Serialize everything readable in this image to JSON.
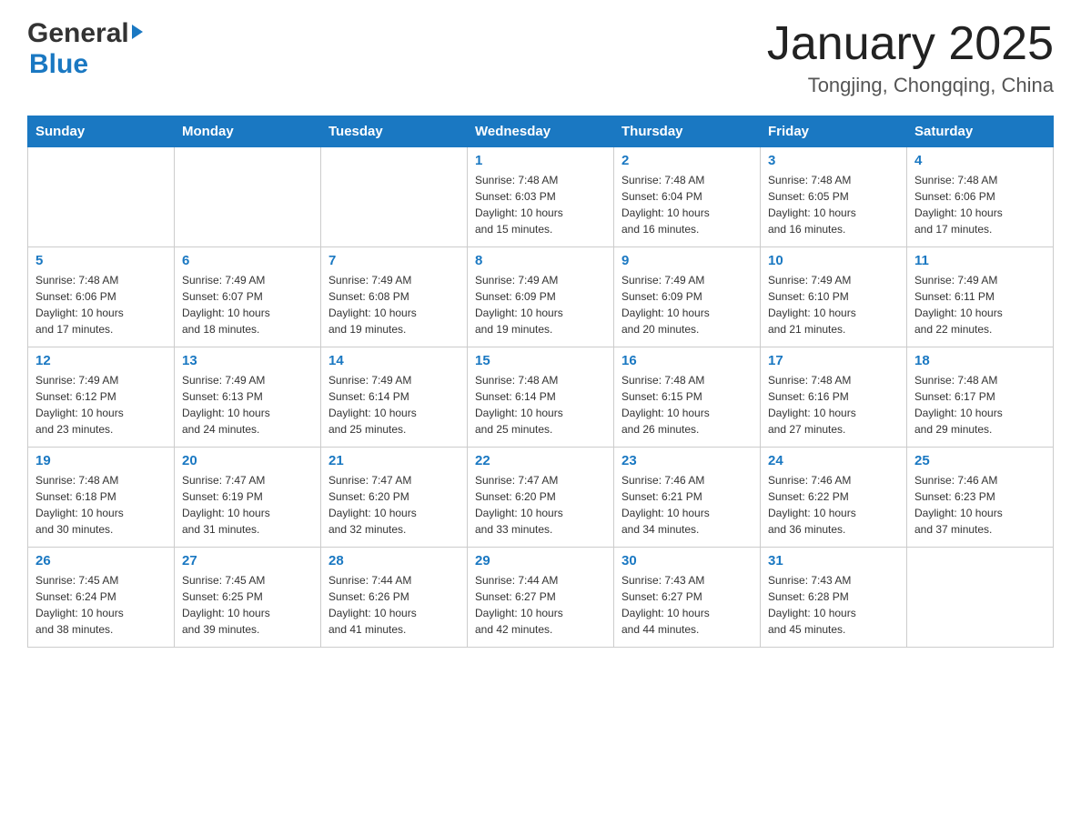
{
  "header": {
    "logo_general": "General",
    "logo_blue": "Blue",
    "month_title": "January 2025",
    "location": "Tongjing, Chongqing, China"
  },
  "weekdays": [
    "Sunday",
    "Monday",
    "Tuesday",
    "Wednesday",
    "Thursday",
    "Friday",
    "Saturday"
  ],
  "weeks": [
    [
      {
        "day": "",
        "info": ""
      },
      {
        "day": "",
        "info": ""
      },
      {
        "day": "",
        "info": ""
      },
      {
        "day": "1",
        "info": "Sunrise: 7:48 AM\nSunset: 6:03 PM\nDaylight: 10 hours\nand 15 minutes."
      },
      {
        "day": "2",
        "info": "Sunrise: 7:48 AM\nSunset: 6:04 PM\nDaylight: 10 hours\nand 16 minutes."
      },
      {
        "day": "3",
        "info": "Sunrise: 7:48 AM\nSunset: 6:05 PM\nDaylight: 10 hours\nand 16 minutes."
      },
      {
        "day": "4",
        "info": "Sunrise: 7:48 AM\nSunset: 6:06 PM\nDaylight: 10 hours\nand 17 minutes."
      }
    ],
    [
      {
        "day": "5",
        "info": "Sunrise: 7:48 AM\nSunset: 6:06 PM\nDaylight: 10 hours\nand 17 minutes."
      },
      {
        "day": "6",
        "info": "Sunrise: 7:49 AM\nSunset: 6:07 PM\nDaylight: 10 hours\nand 18 minutes."
      },
      {
        "day": "7",
        "info": "Sunrise: 7:49 AM\nSunset: 6:08 PM\nDaylight: 10 hours\nand 19 minutes."
      },
      {
        "day": "8",
        "info": "Sunrise: 7:49 AM\nSunset: 6:09 PM\nDaylight: 10 hours\nand 19 minutes."
      },
      {
        "day": "9",
        "info": "Sunrise: 7:49 AM\nSunset: 6:09 PM\nDaylight: 10 hours\nand 20 minutes."
      },
      {
        "day": "10",
        "info": "Sunrise: 7:49 AM\nSunset: 6:10 PM\nDaylight: 10 hours\nand 21 minutes."
      },
      {
        "day": "11",
        "info": "Sunrise: 7:49 AM\nSunset: 6:11 PM\nDaylight: 10 hours\nand 22 minutes."
      }
    ],
    [
      {
        "day": "12",
        "info": "Sunrise: 7:49 AM\nSunset: 6:12 PM\nDaylight: 10 hours\nand 23 minutes."
      },
      {
        "day": "13",
        "info": "Sunrise: 7:49 AM\nSunset: 6:13 PM\nDaylight: 10 hours\nand 24 minutes."
      },
      {
        "day": "14",
        "info": "Sunrise: 7:49 AM\nSunset: 6:14 PM\nDaylight: 10 hours\nand 25 minutes."
      },
      {
        "day": "15",
        "info": "Sunrise: 7:48 AM\nSunset: 6:14 PM\nDaylight: 10 hours\nand 25 minutes."
      },
      {
        "day": "16",
        "info": "Sunrise: 7:48 AM\nSunset: 6:15 PM\nDaylight: 10 hours\nand 26 minutes."
      },
      {
        "day": "17",
        "info": "Sunrise: 7:48 AM\nSunset: 6:16 PM\nDaylight: 10 hours\nand 27 minutes."
      },
      {
        "day": "18",
        "info": "Sunrise: 7:48 AM\nSunset: 6:17 PM\nDaylight: 10 hours\nand 29 minutes."
      }
    ],
    [
      {
        "day": "19",
        "info": "Sunrise: 7:48 AM\nSunset: 6:18 PM\nDaylight: 10 hours\nand 30 minutes."
      },
      {
        "day": "20",
        "info": "Sunrise: 7:47 AM\nSunset: 6:19 PM\nDaylight: 10 hours\nand 31 minutes."
      },
      {
        "day": "21",
        "info": "Sunrise: 7:47 AM\nSunset: 6:20 PM\nDaylight: 10 hours\nand 32 minutes."
      },
      {
        "day": "22",
        "info": "Sunrise: 7:47 AM\nSunset: 6:20 PM\nDaylight: 10 hours\nand 33 minutes."
      },
      {
        "day": "23",
        "info": "Sunrise: 7:46 AM\nSunset: 6:21 PM\nDaylight: 10 hours\nand 34 minutes."
      },
      {
        "day": "24",
        "info": "Sunrise: 7:46 AM\nSunset: 6:22 PM\nDaylight: 10 hours\nand 36 minutes."
      },
      {
        "day": "25",
        "info": "Sunrise: 7:46 AM\nSunset: 6:23 PM\nDaylight: 10 hours\nand 37 minutes."
      }
    ],
    [
      {
        "day": "26",
        "info": "Sunrise: 7:45 AM\nSunset: 6:24 PM\nDaylight: 10 hours\nand 38 minutes."
      },
      {
        "day": "27",
        "info": "Sunrise: 7:45 AM\nSunset: 6:25 PM\nDaylight: 10 hours\nand 39 minutes."
      },
      {
        "day": "28",
        "info": "Sunrise: 7:44 AM\nSunset: 6:26 PM\nDaylight: 10 hours\nand 41 minutes."
      },
      {
        "day": "29",
        "info": "Sunrise: 7:44 AM\nSunset: 6:27 PM\nDaylight: 10 hours\nand 42 minutes."
      },
      {
        "day": "30",
        "info": "Sunrise: 7:43 AM\nSunset: 6:27 PM\nDaylight: 10 hours\nand 44 minutes."
      },
      {
        "day": "31",
        "info": "Sunrise: 7:43 AM\nSunset: 6:28 PM\nDaylight: 10 hours\nand 45 minutes."
      },
      {
        "day": "",
        "info": ""
      }
    ]
  ]
}
